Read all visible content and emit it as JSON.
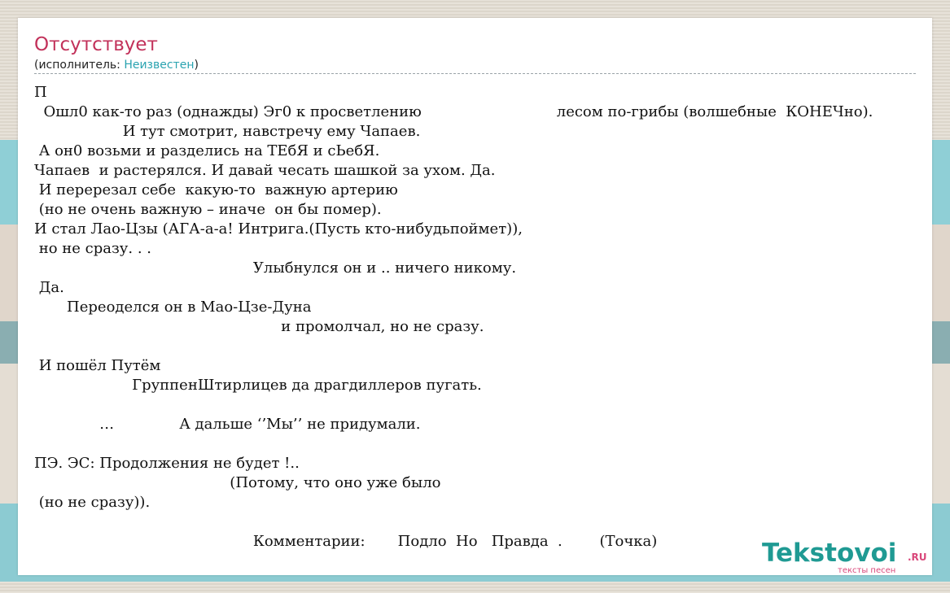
{
  "song": {
    "title": "Отсутствует",
    "performer_prefix": "(исполнитель: ",
    "performer_name": "Неизвестен",
    "performer_suffix": ")"
  },
  "lyrics": [
    "П",
    "  Ошл0 как-то раз (однажды) Эг0 к просветлению                             лесом по-грибы (волшебные  КОНЕЧно).",
    "                   И тут смотрит, навстречу ему Чапаев.",
    " А он0 возьми и разделись на ТЕбЯ и сЬебЯ.",
    "Чапаев  и растерялся. И давай чесать шашкой за ухом. Да.",
    " И перерезал себе  какую-то  важную артерию",
    " (но не очень важную – иначе  он бы помер).",
    "И стал Лао-Цзы (АГА-а-а! Интрига.(Пусть кто-нибудьпоймет)),",
    " но не сразу. . .",
    "                                               Улыбнулся он и .. ничего никому.",
    " Да.",
    "       Переоделся он в Мао-Цзе-Дуна",
    "                                                     и промолчал, но не сразу.",
    "",
    " И пошёл Путём",
    "                     ГруппенШтирлицев да драгдиллеров пугать.",
    "",
    "              …              А дальше ‘’Мы’’ не придумали.",
    "",
    "ПЭ. ЭС: Продолжения не будет !..",
    "                                          (Потому, что оно уже было",
    " (но не сразу)).",
    "",
    "                                               Комментарии:       Подло  Но   Правда  .        (Точка)"
  ],
  "logo": {
    "name": "Tekstovoi",
    "tld": ".RU",
    "tagline": "тексты песен"
  }
}
